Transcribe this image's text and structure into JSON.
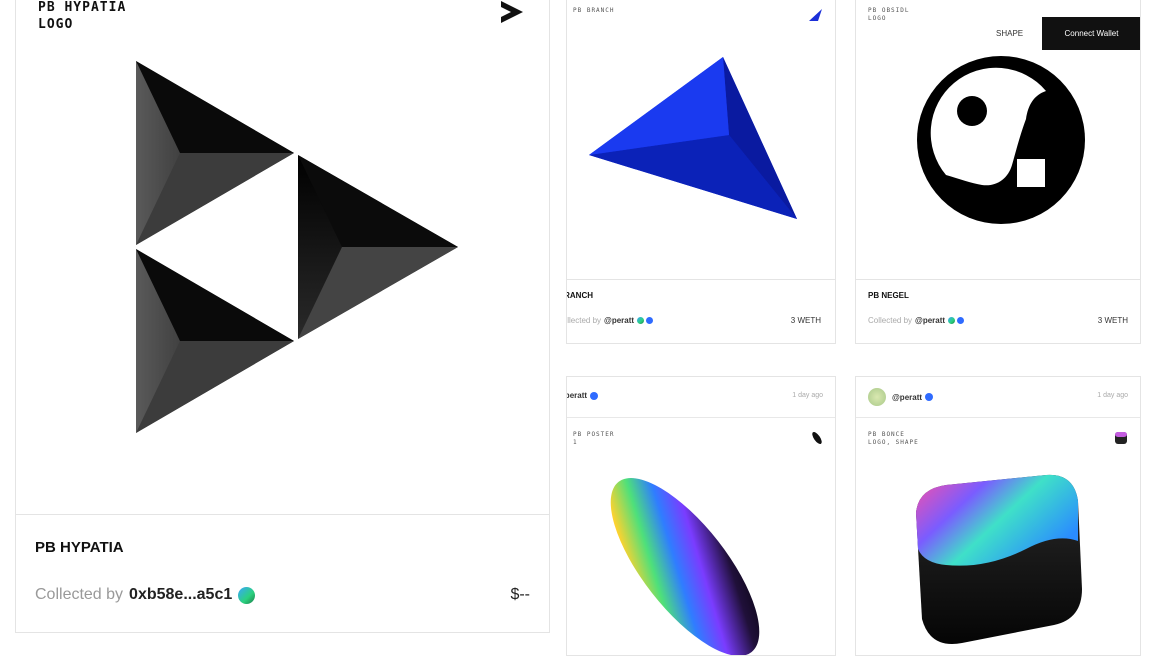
{
  "main_card": {
    "art_label_line1": "PB HYPATIA",
    "art_label_line2": "LOGO",
    "title": "PB HYPATIA",
    "collected_prefix": "Collected by",
    "collector": "0xb58e...a5c1",
    "price": "$--"
  },
  "card_blue": {
    "art_label": "PB BRANCH",
    "title": "PB BRANCH",
    "collected_prefix": "Collected by",
    "collector": "@peratt",
    "price": "3 WETH"
  },
  "card_yinyang": {
    "art_label_line1": "PB OBSIDL",
    "art_label_line2": "LOGO",
    "nav_label": "SHAPE",
    "connect_wallet_label": "Connect Wallet",
    "title": "PB NEGEL",
    "collected_prefix": "Collected by",
    "collector": "@peratt",
    "price": "3 WETH"
  },
  "card_rainbow_ellipse": {
    "poster": "@peratt",
    "time": "1 day ago",
    "art_label_line1": "PB POSTER",
    "art_label_line2": "1"
  },
  "card_rainbow_cube": {
    "poster": "@peratt",
    "time": "1 day ago",
    "art_label_line1": "PB BONCE",
    "art_label_line2": "LOGO, SHAPE"
  }
}
